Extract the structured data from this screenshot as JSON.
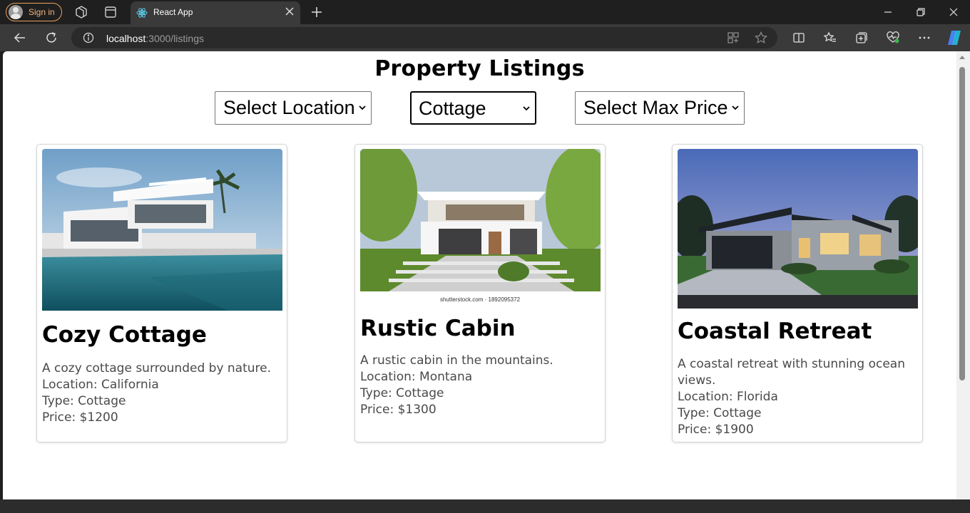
{
  "browser": {
    "signin_label": "Sign in",
    "tab_title": "React App",
    "url_host": "localhost",
    "url_path": ":3000/listings"
  },
  "page": {
    "title": "Property Listings",
    "filters": {
      "location": "Select Location",
      "type": "Cottage",
      "max_price": "Select Max Price"
    },
    "listings": [
      {
        "name": "Cozy Cottage",
        "description": "A cozy cottage surrounded by nature.",
        "location": "Location: California",
        "type": "Type: Cottage",
        "price": "Price: $1200"
      },
      {
        "name": "Rustic Cabin",
        "description": "A rustic cabin in the mountains.",
        "location": "Location: Montana",
        "type": "Type: Cottage",
        "price": "Price: $1300",
        "image_caption": "shutterstock.com · 1892095372"
      },
      {
        "name": "Coastal Retreat",
        "description": "A coastal retreat with stunning ocean views.",
        "location": "Location: Florida",
        "type": "Type: Cottage",
        "price": "Price: $1900"
      }
    ]
  },
  "colors": {
    "signin_accent": "#e8a25d",
    "react_logo": "#61dafb",
    "copilot_a": "#1ea1f2",
    "copilot_b": "#7b5cf0"
  }
}
